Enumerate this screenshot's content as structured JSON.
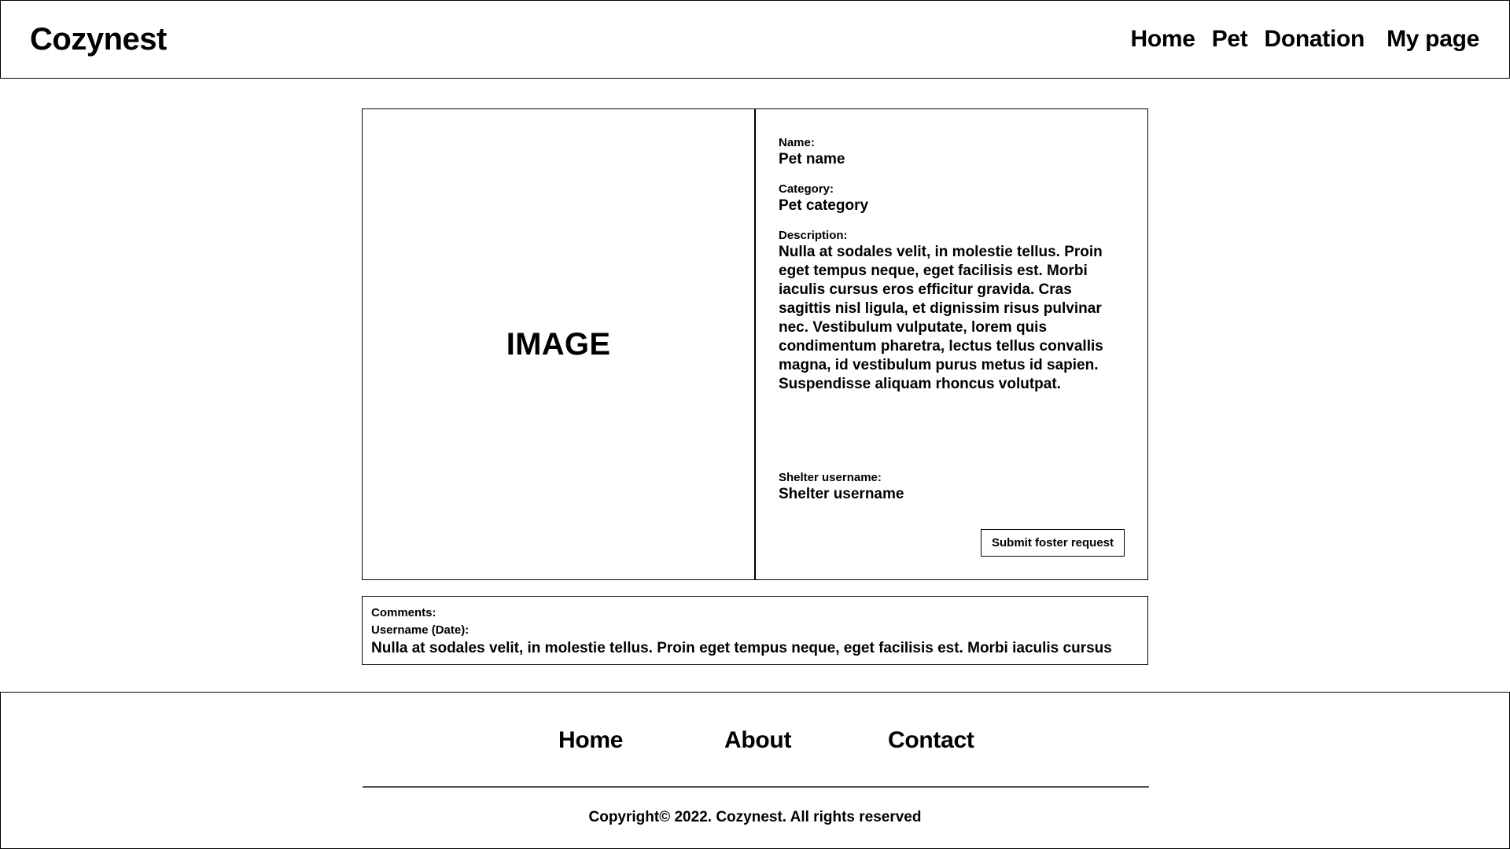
{
  "header": {
    "brand": "Cozynest",
    "nav": [
      {
        "label": "Home"
      },
      {
        "label": "Pet"
      },
      {
        "label": "Donation"
      },
      {
        "label": "My page"
      }
    ]
  },
  "pet": {
    "image_placeholder": "IMAGE",
    "name_label": "Name:",
    "name_value": "Pet name",
    "category_label": "Category:",
    "category_value": "Pet category",
    "description_label": "Description:",
    "description_value": "Nulla at sodales velit, in molestie tellus. Proin eget tempus neque, eget facilisis est. Morbi iaculis cursus eros efficitur gravida. Cras sagittis nisl ligula, et dignissim risus pulvinar nec. Vestibulum vulputate, lorem quis condimentum pharetra, lectus tellus convallis magna, id vestibulum purus metus id sapien. Suspendisse aliquam rhoncus volutpat.",
    "shelter_label": "Shelter username:",
    "shelter_value": "Shelter username",
    "submit_label": "Submit foster request"
  },
  "comments": {
    "label": "Comments:",
    "items": [
      {
        "author_date": "Username (Date):",
        "text": "Nulla at sodales velit, in molestie tellus. Proin eget tempus neque, eget facilisis est. Morbi iaculis cursus"
      }
    ]
  },
  "footer": {
    "nav": [
      {
        "label": "Home"
      },
      {
        "label": "About"
      },
      {
        "label": "Contact"
      }
    ],
    "copyright": "Copyright© 2022. Cozynest. All rights reserved"
  }
}
